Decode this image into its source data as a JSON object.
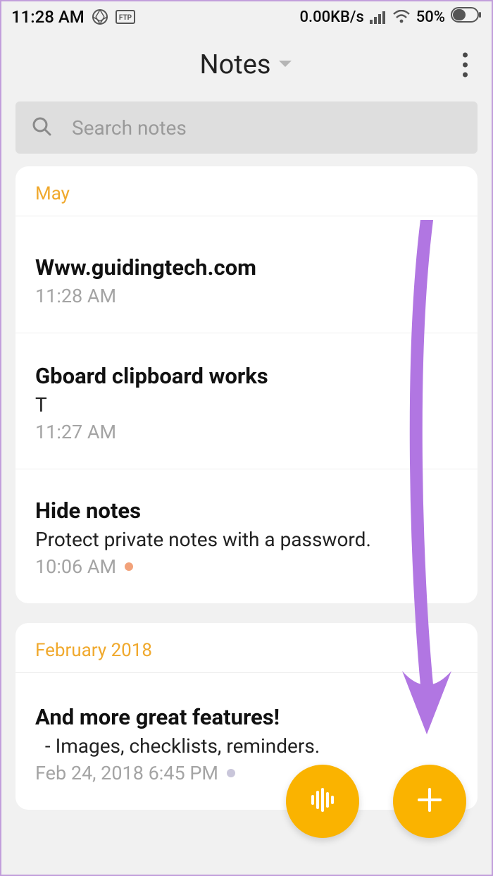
{
  "status": {
    "time": "11:28 AM",
    "network_speed": "0.00KB/s",
    "battery_pct": "50%"
  },
  "header": {
    "title": "Notes"
  },
  "search": {
    "placeholder": "Search notes"
  },
  "sections": [
    {
      "header": "May",
      "notes": [
        {
          "title": "Www.guidingtech.com",
          "subtitle": "",
          "time": "11:28 AM",
          "dot": ""
        },
        {
          "title": "Gboard clipboard works",
          "subtitle": "T",
          "time": "11:27 AM",
          "dot": ""
        },
        {
          "title": "Hide notes",
          "subtitle": "Protect private notes with a password.",
          "time": "10:06 AM",
          "dot": "orange"
        }
      ]
    },
    {
      "header": "February 2018",
      "notes": [
        {
          "title": "And more great features!",
          "subtitle": "  - Images, checklists, reminders.",
          "time": "Feb 24, 2018 6:45 PM",
          "dot": "gray"
        }
      ]
    }
  ],
  "colors": {
    "accent": "#fab300",
    "section_header": "#f0a92d",
    "overlay_arrow": "#b176e2"
  }
}
